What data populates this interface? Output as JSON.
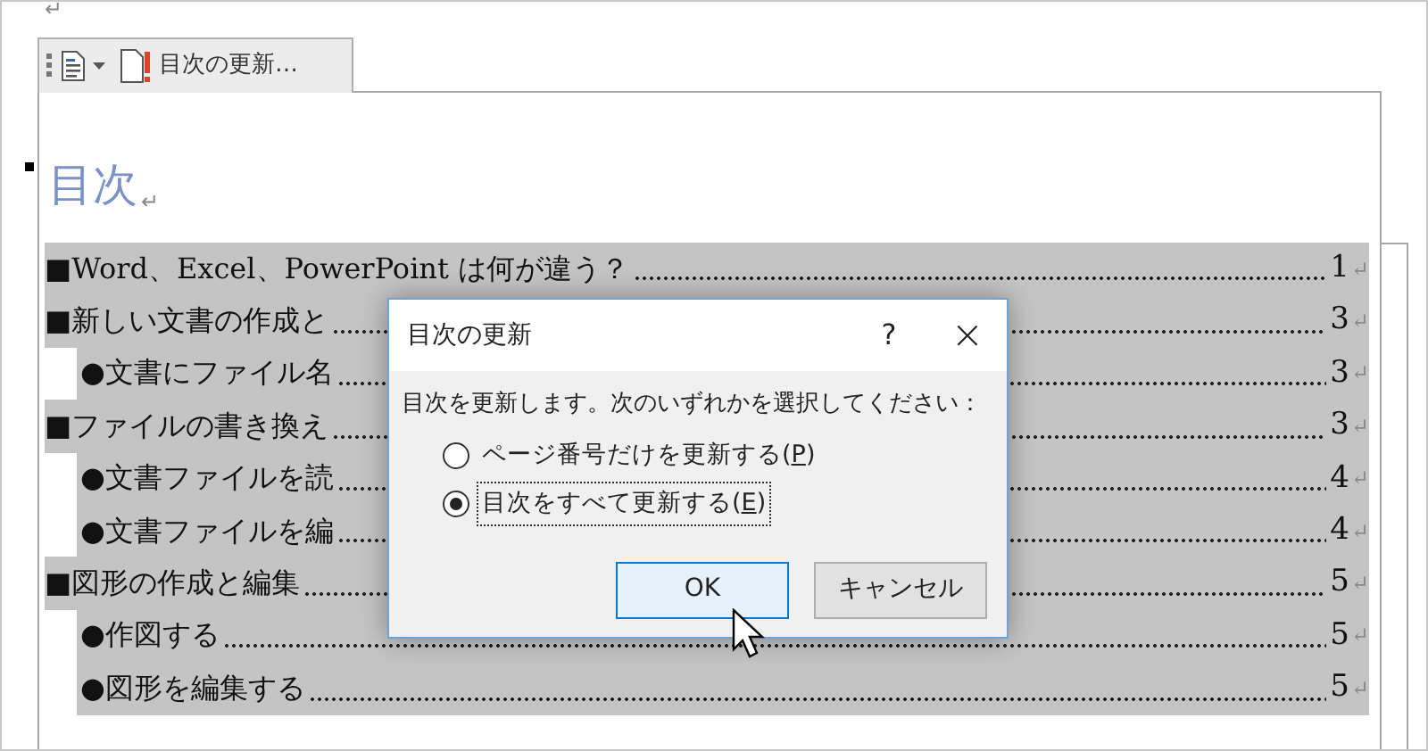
{
  "document": {
    "top_mark": "↵",
    "toolbar": {
      "label": "目次の更新…"
    },
    "heading": {
      "text": "目次",
      "mark": "↵"
    },
    "toc": [
      {
        "kind": "level1",
        "title": "■Word、Excel、PowerPoint は何が違う？",
        "page": "1",
        "mark": "↵"
      },
      {
        "kind": "level1",
        "title": "■新しい文書の作成と",
        "page": "3",
        "mark": "↵"
      },
      {
        "kind": "level2",
        "title": "●文書にファイル名",
        "page": "3",
        "mark": "↵"
      },
      {
        "kind": "level1",
        "title": "■ファイルの書き換え",
        "page": "3",
        "mark": "↵"
      },
      {
        "kind": "level2",
        "title": "●文書ファイルを読",
        "page": "4",
        "mark": "↵"
      },
      {
        "kind": "level2",
        "title": "●文書ファイルを編",
        "page": "4",
        "mark": "↵"
      },
      {
        "kind": "level1",
        "title": "■図形の作成と編集",
        "page": "5",
        "mark": "↵"
      },
      {
        "kind": "level2",
        "title": "●作図する",
        "page": "5",
        "mark": "↵"
      },
      {
        "kind": "level2",
        "title": "●図形を編集する",
        "page": "5",
        "mark": "↵"
      }
    ]
  },
  "dialog": {
    "title": "目次の更新",
    "help": "?",
    "close": "×",
    "prompt": "目次を更新します。次のいずれかを選択してください：",
    "options": [
      {
        "label_before": "ページ番号だけを更新する(",
        "access_key": "P",
        "label_after": ")",
        "selected": false,
        "focused": false
      },
      {
        "label_before": "目次をすべて更新する(",
        "access_key": "E",
        "label_after": ")",
        "selected": true,
        "focused": true
      }
    ],
    "buttons": [
      {
        "label": "OK",
        "default": true
      },
      {
        "label": "キャンセル",
        "default": false
      }
    ]
  }
}
